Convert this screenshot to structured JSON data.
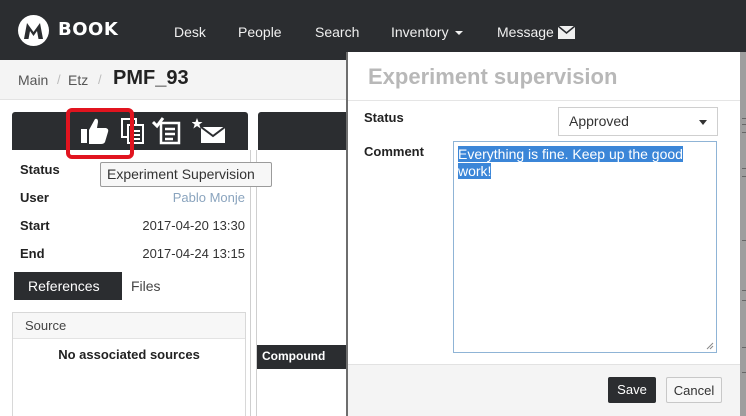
{
  "nav": {
    "brand": "BOOK",
    "items": [
      "Desk",
      "People",
      "Search",
      "Inventory",
      "Message"
    ]
  },
  "breadcrumb": {
    "root": "Main",
    "sep1": "/",
    "parent": "Etz",
    "sep2": "/",
    "title": "PMF_93"
  },
  "toolbar": {
    "icons": [
      "thumbs-up-icon",
      "copy-document-icon",
      "checklist-icon",
      "envelope-star-icon"
    ],
    "tooltip": "Experiment Supervision"
  },
  "details": {
    "status_label": "Status",
    "user_label": "User",
    "user_value": "Pablo Monje",
    "start_label": "Start",
    "start_value": "2017-04-20 13:30",
    "end_label": "End",
    "end_value": "2017-04-24 13:15"
  },
  "tabs": {
    "active": "References",
    "other": "Files"
  },
  "references": {
    "header": "Source",
    "empty": "No associated sources"
  },
  "compound_label": "Compound",
  "modal": {
    "title": "Experiment supervision",
    "status_label": "Status",
    "status_value": "Approved",
    "comment_label": "Comment",
    "comment_text": "Everything is fine. Keep up the good work!",
    "save": "Save",
    "cancel": "Cancel"
  },
  "colors": {
    "dark": "#2b2d30",
    "highlight": "#e1141f",
    "selection": "#3b86d8"
  }
}
